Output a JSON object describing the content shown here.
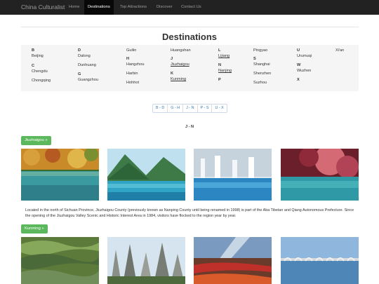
{
  "navbar": {
    "brand": "China Culturalist",
    "items": [
      {
        "label": "Home"
      },
      {
        "label": "Destinations"
      },
      {
        "label": "Top Attractions"
      },
      {
        "label": "Discover"
      },
      {
        "label": "Contact Us"
      }
    ]
  },
  "page_title": "Destinations",
  "index": {
    "letters": {
      "B": "B",
      "C": "C",
      "D": "D",
      "G": "G",
      "H": "H",
      "J": "J",
      "K": "K",
      "L": "L",
      "N": "N",
      "P": "P",
      "S": "S",
      "U": "U",
      "W": "W",
      "X": "X"
    },
    "cities": {
      "beijing": "Beijing",
      "chengdu": "Chengdu",
      "chongqing": "Chongqing",
      "dalong": "Dalong",
      "dunhuang": "Dunhuang",
      "guangzhou": "Guangzhou",
      "guilin": "Guilin",
      "hangzhou": "Hangzhou",
      "harbin": "Harbin",
      "hohhot": "Hohhot",
      "huangshan": "Huangshan",
      "jiuzhaigou": "Jiuzhaigou",
      "kunming": "Kunming",
      "lijiang": "Lijiang",
      "nanjing": "Nanjing",
      "pingyao": "Pingyao",
      "shanghai": "Shanghai",
      "shenzhen": "Shenzhen",
      "suzhou": "Suzhou",
      "urumuqi": "Urumuqi",
      "wuzhen": "Wuzhen",
      "xian": "Xi'an"
    }
  },
  "pager": [
    "B - D",
    "G - H",
    "J - N",
    "P - S",
    "U - X"
  ],
  "section_heading": "J - N",
  "sections": [
    {
      "button": "Jiuzhaigou »",
      "description": "Located in the north of Sichuan Province, Jiuzhaigou County (previously known as Nanping County until being renamed in 1998) is part of the Aba Tibetan and Qiang Autonomous Prefecture. Since the opening of the Jiuzhaigou Valley Scenic and Historic Interest Area in 1984, visitors have flocked to the region year by year."
    },
    {
      "button": "Kunming »"
    }
  ]
}
